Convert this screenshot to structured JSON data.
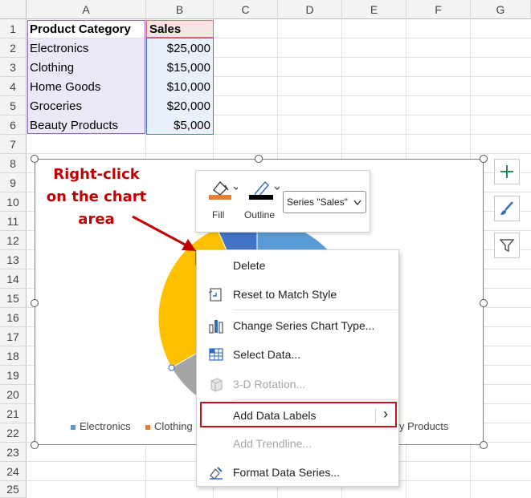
{
  "columns": [
    "A",
    "B",
    "C",
    "D",
    "E",
    "F",
    "G"
  ],
  "rows": [
    "1",
    "2",
    "3",
    "4",
    "5",
    "6",
    "7",
    "8",
    "9",
    "10",
    "11",
    "12",
    "13",
    "14",
    "15",
    "16",
    "17",
    "18",
    "19",
    "20",
    "21",
    "22",
    "23",
    "24",
    "25"
  ],
  "table": {
    "headers": [
      "Product Category",
      "Sales"
    ],
    "rows": [
      {
        "category": "Electronics",
        "sales": "$25,000"
      },
      {
        "category": "Clothing",
        "sales": "$15,000"
      },
      {
        "category": "Home Goods",
        "sales": "$10,000"
      },
      {
        "category": "Groceries",
        "sales": "$20,000"
      },
      {
        "category": "Beauty Products",
        "sales": "$5,000"
      }
    ]
  },
  "chart_data": {
    "type": "pie",
    "categories": [
      "Electronics",
      "Clothing",
      "Home Goods",
      "Groceries",
      "Beauty Products"
    ],
    "values": [
      25000,
      15000,
      10000,
      20000,
      5000
    ],
    "colors": [
      "#5b9bd5",
      "#ed7d31",
      "#a5a5a5",
      "#ffc000",
      "#4472c4"
    ],
    "legend_position": "bottom",
    "legend_visible": [
      "Electronics",
      "Clothing",
      "y Products"
    ]
  },
  "annotation": {
    "line1": "Right-click",
    "line2": "on the chart",
    "line3": "area"
  },
  "mini_toolbar": {
    "fill_label": "Fill",
    "outline_label": "Outline",
    "series_select": "Series \"Sales\"",
    "fill_color": "#ed7d31",
    "outline_color": "#000000"
  },
  "context_menu": {
    "items": [
      {
        "label": "Delete",
        "enabled": true
      },
      {
        "label": "Reset to Match Style",
        "enabled": true
      },
      {
        "label": "Change Series Chart Type...",
        "enabled": true
      },
      {
        "label": "Select Data...",
        "enabled": true
      },
      {
        "label": "3-D Rotation...",
        "enabled": false
      },
      {
        "label": "Add Data Labels",
        "enabled": true,
        "submenu": true
      },
      {
        "label": "Add Trendline...",
        "enabled": false
      },
      {
        "label": "Format Data Series...",
        "enabled": true
      }
    ],
    "submenu_arrow": "›"
  },
  "side_buttons": [
    "plus-icon",
    "brush-icon",
    "filter-icon"
  ],
  "accent": "#c0141b"
}
